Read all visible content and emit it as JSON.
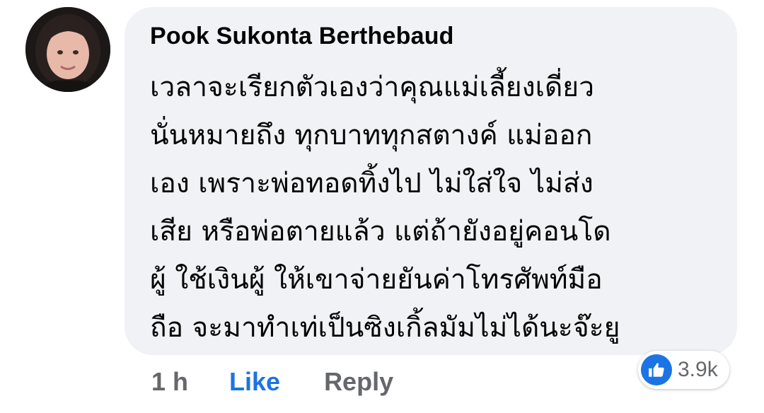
{
  "comment": {
    "author": "Pook Sukonta Berthebaud",
    "lines": [
      "เวลาจะเรียกตัวเองว่าคุณแม่เลี้ยงเดี่ยว",
      "นั่นหมายถึง ทุกบาททุกสตางค์ แม่ออก",
      "เอง เพราะพ่อทอดทิ้งไป ไม่ใส่ใจ ไม่ส่ง",
      "เสีย หรือพ่อตายแล้ว แต่ถ้ายังอยู่คอนโด",
      "ผู้ ใช้เงินผู้ ให้เขาจ่ายยันค่าโทรศัพท์มือ",
      "ถือ จะมาทำเท่เป็นซิงเกิ้ลมัมไม่ได้นะจ๊ะยู"
    ],
    "time": "1 h",
    "like_label": "Like",
    "reply_label": "Reply",
    "reaction_count": "3.9k",
    "reaction_icon": "thumbs-up-icon"
  },
  "colors": {
    "bubble": "#f0f2f5",
    "like_blue": "#1b74e4",
    "meta_gray": "#65676b",
    "text": "#050505"
  }
}
